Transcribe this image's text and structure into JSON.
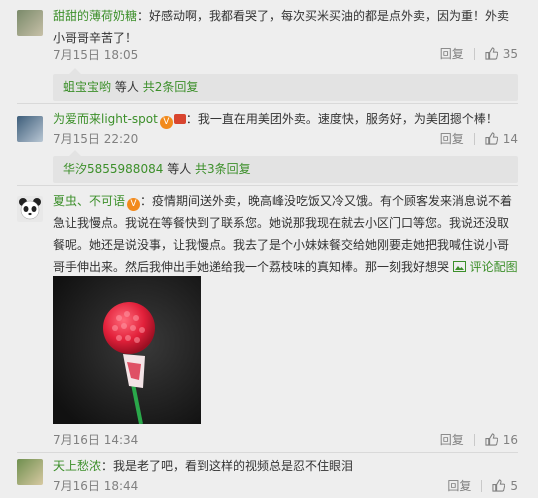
{
  "comments": [
    {
      "user": "甜甜的薄荷奶糖",
      "text": "好感动啊，我都看哭了，每次买米买油的都是点外卖，因为重！外卖小哥哥辛苦了！",
      "time": "7月15日 18:05",
      "reply_label": "回复",
      "likes": "35",
      "replies": {
        "user": "蛆宝宝哟",
        "suffix": "等人",
        "count": "共2条回复"
      }
    },
    {
      "user": "为爱而来light-spot",
      "text": "我一直在用美团外卖。速度快，服务好，为美团摁个棒！",
      "time": "7月15日 22:20",
      "reply_label": "回复",
      "likes": "14",
      "replies": {
        "user": "华汐5855988084",
        "suffix": "等人",
        "count": "共3条回复"
      }
    },
    {
      "user": "夏虫、不可语",
      "text": "疫情期间送外卖，晚高峰没吃饭又冷又饿。有个顾客发来消息说不着急让我慢点。我说在等餐快到了联系您。她说那我现在就去小区门口等您。我说还没取餐呢。她还是说没事，让我慢点。我去了是个小妹妹餐交给她刚要走她把我喊住说小哥哥手伸出来。然后我伸出手她递给我一个荔枝味的真知棒。那一刻我好想哭",
      "pic_link": "评论配图",
      "time": "7月16日 14:34",
      "reply_label": "回复",
      "likes": "16"
    },
    {
      "user": "天上愁浓",
      "text": "我是老了吧，看到这样的视频总是忍不住眼泪",
      "time": "7月16日 18:44",
      "reply_label": "回复",
      "likes": "5"
    }
  ],
  "colors": {
    "username": "#3c8f2a",
    "muted": "#808080",
    "background": "#eeeeee"
  },
  "icons": {
    "like": "thumbs-up-icon",
    "picture": "picture-icon",
    "badge": "vip-badge-icon"
  }
}
